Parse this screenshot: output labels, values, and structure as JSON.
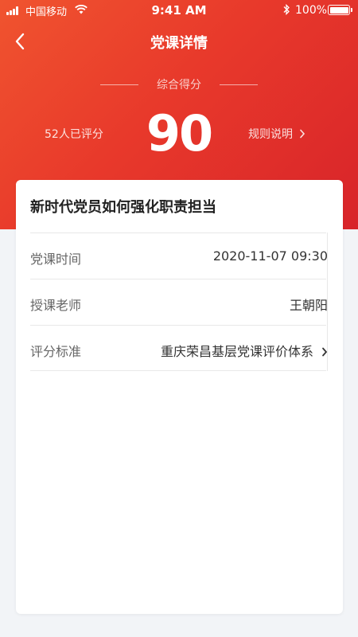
{
  "status_bar": {
    "carrier": "中国移动",
    "time": "9:41 AM",
    "battery": "100%"
  },
  "nav": {
    "title": "党课详情",
    "back_icon": "chevron-left-icon"
  },
  "score": {
    "label": "综合得分",
    "value": "90",
    "raters": "52人已评分",
    "rules_label": "规则说明"
  },
  "course": {
    "title": "新时代党员如何强化职责担当",
    "fields": [
      {
        "label": "党课时间",
        "value": "2020-11-07 09:30"
      },
      {
        "label": "授课老师",
        "value": "王朝阳"
      },
      {
        "label": "评分标准",
        "value": "重庆荣昌基层党课评价体系"
      }
    ]
  },
  "colors": {
    "header_gradient_start": "#f0542f",
    "header_gradient_end": "#d8242a",
    "page_bg": "#f2f4f7"
  }
}
